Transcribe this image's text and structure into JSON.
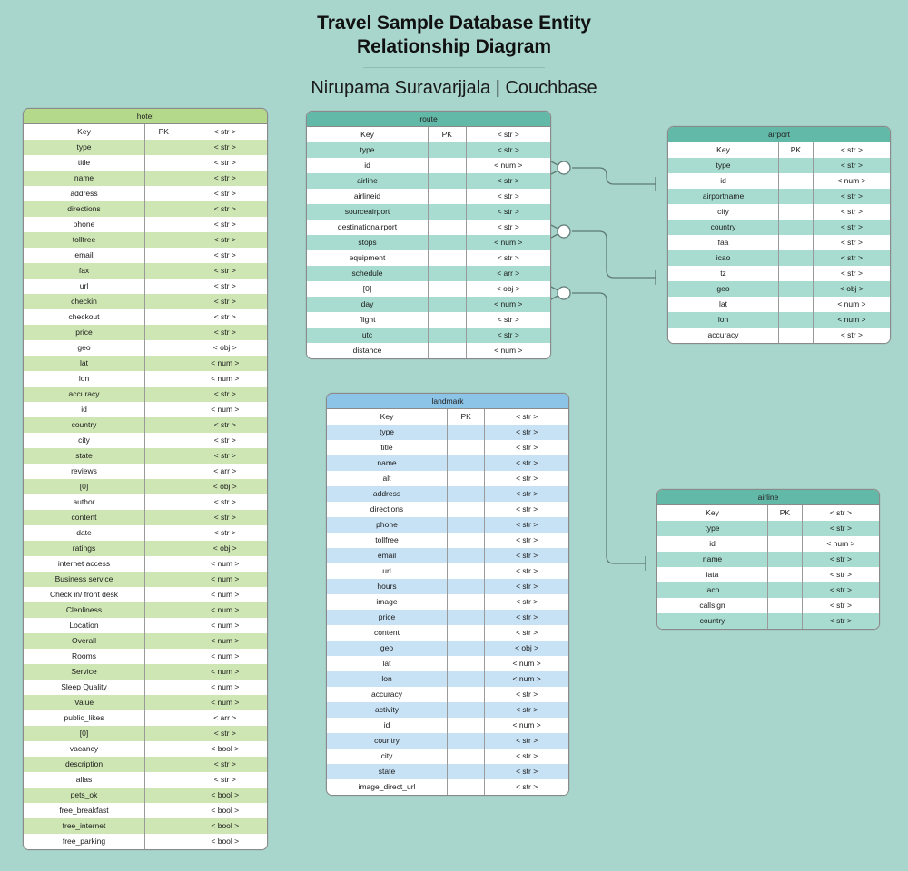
{
  "header": {
    "title_line1": "Travel Sample Database Entity",
    "title_line2": "Relationship Diagram",
    "subtitle": "Nirupama Suravarjjala | Couchbase"
  },
  "colors": {
    "background": "#a8d5cc",
    "green_header": "#b5d98a",
    "green_stripe": "#cee6b4",
    "teal_header": "#63b9a8",
    "teal_stripe": "#a8dcd0",
    "blue_header": "#8cc4e8",
    "blue_stripe": "#c8e2f5",
    "connector": "#5f7b76",
    "border": "#8a8a8a"
  },
  "columns": {
    "name": "Key",
    "pk": "PK",
    "type": "< str >"
  },
  "entities": {
    "hotel": {
      "name": "hotel",
      "theme": "green",
      "fields": [
        {
          "name": "Key",
          "pk": "PK",
          "type": "< str >"
        },
        {
          "name": "type",
          "pk": "",
          "type": "< str >"
        },
        {
          "name": "title",
          "pk": "",
          "type": "< str >"
        },
        {
          "name": "name",
          "pk": "",
          "type": "< str >"
        },
        {
          "name": "address",
          "pk": "",
          "type": "< str >"
        },
        {
          "name": "directions",
          "pk": "",
          "type": "< str >"
        },
        {
          "name": "phone",
          "pk": "",
          "type": "< str >"
        },
        {
          "name": "tollfree",
          "pk": "",
          "type": "< str >"
        },
        {
          "name": "email",
          "pk": "",
          "type": "< str >"
        },
        {
          "name": "fax",
          "pk": "",
          "type": "< str >"
        },
        {
          "name": "url",
          "pk": "",
          "type": "< str >"
        },
        {
          "name": "checkin",
          "pk": "",
          "type": "< str >"
        },
        {
          "name": "checkout",
          "pk": "",
          "type": "< str >"
        },
        {
          "name": "price",
          "pk": "",
          "type": "< str >"
        },
        {
          "name": "geo",
          "pk": "",
          "type": "< obj >"
        },
        {
          "name": "lat",
          "pk": "",
          "type": "< num >"
        },
        {
          "name": "lon",
          "pk": "",
          "type": "< num >"
        },
        {
          "name": "accuracy",
          "pk": "",
          "type": "< str >"
        },
        {
          "name": "id",
          "pk": "",
          "type": "< num >"
        },
        {
          "name": "country",
          "pk": "",
          "type": "< str >"
        },
        {
          "name": "city",
          "pk": "",
          "type": "< str >"
        },
        {
          "name": "state",
          "pk": "",
          "type": "< str >"
        },
        {
          "name": "reviews",
          "pk": "",
          "type": "< arr >"
        },
        {
          "name": "[0]",
          "pk": "",
          "type": "< obj >"
        },
        {
          "name": "author",
          "pk": "",
          "type": "< str >"
        },
        {
          "name": "content",
          "pk": "",
          "type": "< str >"
        },
        {
          "name": "date",
          "pk": "",
          "type": "< str >"
        },
        {
          "name": "ratings",
          "pk": "",
          "type": "< obj >"
        },
        {
          "name": "internet access",
          "pk": "",
          "type": "< num >"
        },
        {
          "name": "Business service",
          "pk": "",
          "type": "< num >"
        },
        {
          "name": "Check in/ front desk",
          "pk": "",
          "type": "< num >"
        },
        {
          "name": "Clenliness",
          "pk": "",
          "type": "< num >"
        },
        {
          "name": "Location",
          "pk": "",
          "type": "< num >"
        },
        {
          "name": "Overall",
          "pk": "",
          "type": "< num >"
        },
        {
          "name": "Rooms",
          "pk": "",
          "type": "< num >"
        },
        {
          "name": "Service",
          "pk": "",
          "type": "< num >"
        },
        {
          "name": "Sleep Quality",
          "pk": "",
          "type": "< num >"
        },
        {
          "name": "Value",
          "pk": "",
          "type": "< num >"
        },
        {
          "name": "public_likes",
          "pk": "",
          "type": "< arr >"
        },
        {
          "name": "[0]",
          "pk": "",
          "type": "< str >"
        },
        {
          "name": "vacancy",
          "pk": "",
          "type": "< bool >"
        },
        {
          "name": "description",
          "pk": "",
          "type": "< str >"
        },
        {
          "name": "allas",
          "pk": "",
          "type": "< str >"
        },
        {
          "name": "pets_ok",
          "pk": "",
          "type": "< bool >"
        },
        {
          "name": "free_breakfast",
          "pk": "",
          "type": "< bool >"
        },
        {
          "name": "free_internet",
          "pk": "",
          "type": "< bool >"
        },
        {
          "name": "free_parking",
          "pk": "",
          "type": "< bool >"
        }
      ]
    },
    "route": {
      "name": "route",
      "theme": "teal",
      "fields": [
        {
          "name": "Key",
          "pk": "PK",
          "type": "< str >"
        },
        {
          "name": "type",
          "pk": "",
          "type": "< str >"
        },
        {
          "name": "id",
          "pk": "",
          "type": "< num >"
        },
        {
          "name": "airline",
          "pk": "",
          "type": "< str >"
        },
        {
          "name": "airlineid",
          "pk": "",
          "type": "< str >"
        },
        {
          "name": "sourceairport",
          "pk": "",
          "type": "< str >"
        },
        {
          "name": "destinationairport",
          "pk": "",
          "type": "< str >"
        },
        {
          "name": "stops",
          "pk": "",
          "type": "< num >"
        },
        {
          "name": "equipment",
          "pk": "",
          "type": "< str >"
        },
        {
          "name": "schedule",
          "pk": "",
          "type": "< arr >"
        },
        {
          "name": "[0]",
          "pk": "",
          "type": "< obj >"
        },
        {
          "name": "day",
          "pk": "",
          "type": "< num >"
        },
        {
          "name": "flight",
          "pk": "",
          "type": "< str >"
        },
        {
          "name": "utc",
          "pk": "",
          "type": "< str >"
        },
        {
          "name": "distance",
          "pk": "",
          "type": "< num >"
        }
      ]
    },
    "airport": {
      "name": "airport",
      "theme": "teal",
      "fields": [
        {
          "name": "Key",
          "pk": "PK",
          "type": "< str >"
        },
        {
          "name": "type",
          "pk": "",
          "type": "< str >"
        },
        {
          "name": "id",
          "pk": "",
          "type": "< num >"
        },
        {
          "name": "airportname",
          "pk": "",
          "type": "< str >"
        },
        {
          "name": "city",
          "pk": "",
          "type": "< str >"
        },
        {
          "name": "country",
          "pk": "",
          "type": "< str >"
        },
        {
          "name": "faa",
          "pk": "",
          "type": "< str >"
        },
        {
          "name": "icao",
          "pk": "",
          "type": "< str >"
        },
        {
          "name": "tz",
          "pk": "",
          "type": "< str >"
        },
        {
          "name": "geo",
          "pk": "",
          "type": "< obj >"
        },
        {
          "name": "lat",
          "pk": "",
          "type": "< num >"
        },
        {
          "name": "lon",
          "pk": "",
          "type": "< num >"
        },
        {
          "name": "accuracy",
          "pk": "",
          "type": "< str >"
        }
      ]
    },
    "landmark": {
      "name": "landmark",
      "theme": "blue",
      "fields": [
        {
          "name": "Key",
          "pk": "PK",
          "type": "< str >"
        },
        {
          "name": "type",
          "pk": "",
          "type": "< str >"
        },
        {
          "name": "title",
          "pk": "",
          "type": "< str >"
        },
        {
          "name": "name",
          "pk": "",
          "type": "< str >"
        },
        {
          "name": "alt",
          "pk": "",
          "type": "< str >"
        },
        {
          "name": "address",
          "pk": "",
          "type": "< str >"
        },
        {
          "name": "directions",
          "pk": "",
          "type": "< str >"
        },
        {
          "name": "phone",
          "pk": "",
          "type": "< str >"
        },
        {
          "name": "tollfree",
          "pk": "",
          "type": "< str >"
        },
        {
          "name": "email",
          "pk": "",
          "type": "< str >"
        },
        {
          "name": "url",
          "pk": "",
          "type": "< str >"
        },
        {
          "name": "hours",
          "pk": "",
          "type": "< str >"
        },
        {
          "name": "image",
          "pk": "",
          "type": "< str >"
        },
        {
          "name": "price",
          "pk": "",
          "type": "< str >"
        },
        {
          "name": "content",
          "pk": "",
          "type": "< str >"
        },
        {
          "name": "geo",
          "pk": "",
          "type": "< obj >"
        },
        {
          "name": "lat",
          "pk": "",
          "type": "< num >"
        },
        {
          "name": "lon",
          "pk": "",
          "type": "< num >"
        },
        {
          "name": "accuracy",
          "pk": "",
          "type": "< str >"
        },
        {
          "name": "activity",
          "pk": "",
          "type": "< str >"
        },
        {
          "name": "id",
          "pk": "",
          "type": "< num >"
        },
        {
          "name": "country",
          "pk": "",
          "type": "< str >"
        },
        {
          "name": "city",
          "pk": "",
          "type": "< str >"
        },
        {
          "name": "state",
          "pk": "",
          "type": "< str >"
        },
        {
          "name": "image_direct_url",
          "pk": "",
          "type": "< str >"
        }
      ]
    },
    "airline": {
      "name": "airline",
      "theme": "teal",
      "fields": [
        {
          "name": "Key",
          "pk": "PK",
          "type": "< str >"
        },
        {
          "name": "type",
          "pk": "",
          "type": "< str >"
        },
        {
          "name": "id",
          "pk": "",
          "type": "< num >"
        },
        {
          "name": "name",
          "pk": "",
          "type": "< str >"
        },
        {
          "name": "iata",
          "pk": "",
          "type": "< str >"
        },
        {
          "name": "iaco",
          "pk": "",
          "type": "< str >"
        },
        {
          "name": "callsign",
          "pk": "",
          "type": "< str >"
        },
        {
          "name": "country",
          "pk": "",
          "type": "< str >"
        }
      ]
    }
  },
  "relationships": [
    {
      "from": "route",
      "from_field": "id",
      "to": "airport",
      "to_field": "id",
      "from_marker": "crowsfoot-zero",
      "to_marker": "one"
    },
    {
      "from": "route",
      "from_field": "destinationairport",
      "to": "airport",
      "to_field": "tz",
      "from_marker": "crowsfoot-zero",
      "to_marker": "one"
    },
    {
      "from": "route",
      "from_field": "[0]",
      "to": "airline",
      "to_field": "name",
      "from_marker": "crowsfoot-zero",
      "to_marker": "one"
    }
  ]
}
